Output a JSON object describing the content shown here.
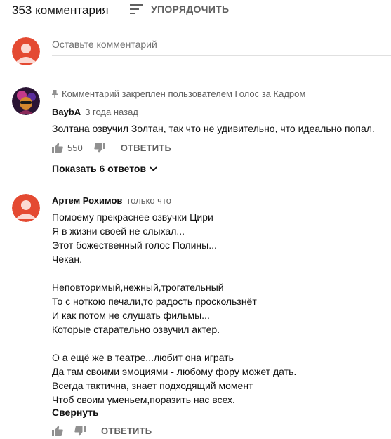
{
  "header": {
    "comment_count": "353 комментария",
    "sort_label": "УПОРЯДОЧИТЬ",
    "sort_icon": "sort-icon"
  },
  "new_comment": {
    "placeholder": "Оставьте комментарий"
  },
  "comments": [
    {
      "pinned_label": "Комментарий закреплен пользователем Голос за Кадром",
      "author": "BaybA",
      "time": "3 года назад",
      "text": "Золтана озвучил Золтан, так что не удивительно, что идеально попал.",
      "likes": "550",
      "reply_label": "ОТВЕТИТЬ",
      "show_replies": "Показать 6 ответов"
    },
    {
      "author": "Артем Рохимов",
      "time": "только что",
      "text": "Помоему прекраснее озвучки Цири\nЯ в жизни своей не слыхал...\nЭтот божественный голос Полины...\nЧекан.\n\nНеповторимый,нежный,трогательный\nТо с ноткою печали,то радость проскользнёт\nИ как потом не слушать фильмы...\nКоторые старательно озвучил актер.\n\nО а ещё же в театре...любит она играть\nДа там своими эмоциями - любому фору может дать.\nВсегда тактична, знает подходящий момент\nЧтоб своим уменьем,поразить нас всех.",
      "collapse_label": "Свернуть",
      "reply_label": "ОТВЕТИТЬ"
    }
  ],
  "colors": {
    "avatar_red": "#e44a32",
    "avatar_silhouette": "#fbd9d3",
    "secondary_text": "#606060",
    "icon_gray": "#909090"
  }
}
